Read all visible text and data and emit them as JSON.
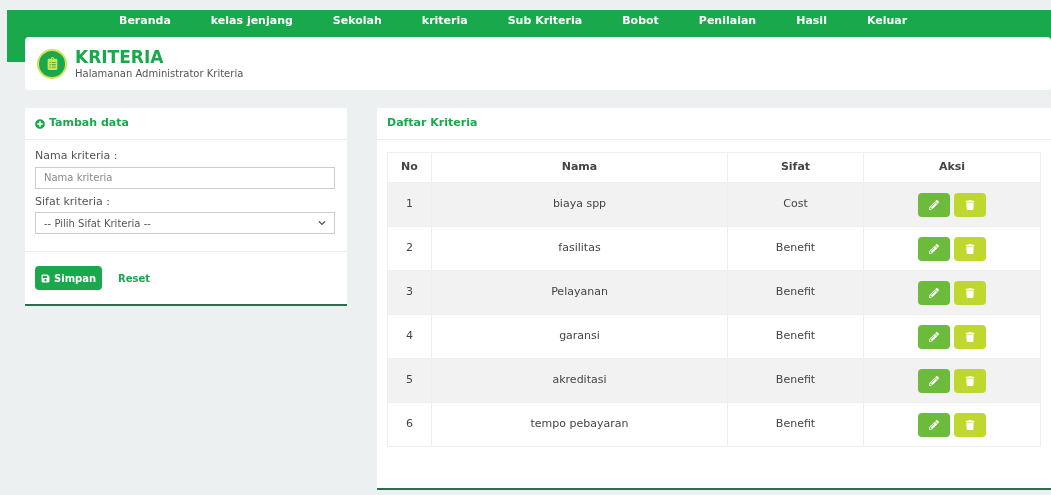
{
  "nav": [
    "Beranda",
    "kelas jenjang",
    "Sekolah",
    "kriteria",
    "Sub Kriteria",
    "Bobot",
    "Penilaian",
    "Hasil",
    "Keluar"
  ],
  "header": {
    "title": "KRITERIA",
    "subtitle": "Halamanan Administrator Kriteria"
  },
  "form": {
    "title": "Tambah data",
    "fields": [
      {
        "kind": "text",
        "label": "Nama kriteria :",
        "placeholder": "Nama kriteria"
      },
      {
        "kind": "select",
        "label": "Sifat kriteria :",
        "value": "-- Pilih Sifat Kriteria --"
      }
    ],
    "save": "Simpan",
    "reset": "Reset"
  },
  "list": {
    "title": "Daftar Kriteria",
    "columns": [
      "No",
      "Nama",
      "Sifat",
      "Aksi"
    ],
    "rows": [
      {
        "no": "1",
        "nama": "biaya spp",
        "sifat": "Cost"
      },
      {
        "no": "2",
        "nama": "fasilitas",
        "sifat": "Benefit"
      },
      {
        "no": "3",
        "nama": "Pelayanan",
        "sifat": "Benefit"
      },
      {
        "no": "4",
        "nama": "garansi",
        "sifat": "Benefit"
      },
      {
        "no": "5",
        "nama": "akreditasi",
        "sifat": "Benefit"
      },
      {
        "no": "6",
        "nama": "tempo pebayaran",
        "sifat": "Benefit"
      }
    ]
  }
}
